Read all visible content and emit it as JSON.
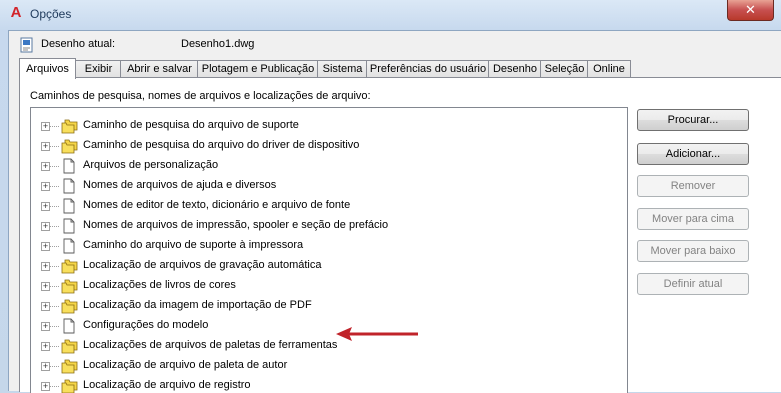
{
  "window": {
    "title": "Opções"
  },
  "current_drawing": {
    "label": "Desenho atual:",
    "value": "Desenho1.dwg"
  },
  "tabs": [
    {
      "label": "Arquivos",
      "active": true
    },
    {
      "label": "Exibir"
    },
    {
      "label": "Abrir e salvar"
    },
    {
      "label": "Plotagem e Publicação"
    },
    {
      "label": "Sistema"
    },
    {
      "label": "Preferências do usuário"
    },
    {
      "label": "Desenho"
    },
    {
      "label": "Seleção"
    },
    {
      "label": "Online"
    }
  ],
  "files": {
    "section_label": "Caminhos de pesquisa, nomes de arquivos e localizações de arquivo:",
    "items": [
      {
        "label": "Caminho de pesquisa do arquivo de suporte",
        "icon": "folders-icon"
      },
      {
        "label": "Caminho de pesquisa do arquivo do driver de dispositivo",
        "icon": "folders-icon"
      },
      {
        "label": "Arquivos de personalização",
        "icon": "document-icon"
      },
      {
        "label": "Nomes de arquivos de ajuda e diversos",
        "icon": "document-icon"
      },
      {
        "label": "Nomes de editor de texto, dicionário e arquivo de fonte",
        "icon": "document-icon"
      },
      {
        "label": "Nomes de arquivos de impressão, spooler e seção de prefácio",
        "icon": "document-icon"
      },
      {
        "label": "Caminho do arquivo de suporte à impressora",
        "icon": "document-icon"
      },
      {
        "label": "Localização de arquivos de gravação automática",
        "icon": "folders-icon"
      },
      {
        "label": "Localizações de livros de cores",
        "icon": "folders-icon"
      },
      {
        "label": "Localização da imagem de importação de PDF",
        "icon": "folders-icon"
      },
      {
        "label": "Configurações do modelo",
        "icon": "document-icon"
      },
      {
        "label": "Localizações de arquivos de paletas de ferramentas",
        "icon": "folders-icon"
      },
      {
        "label": "Localização de arquivo de paleta de autor",
        "icon": "folders-icon"
      },
      {
        "label": "Localização de arquivo de registro",
        "icon": "folders-icon"
      }
    ]
  },
  "buttons": {
    "browse": "Procurar...",
    "add": "Adicionar...",
    "remove": "Remover",
    "move_up": "Mover para cima",
    "move_down": "Mover para baixo",
    "set_current": "Definir atual"
  },
  "colors": {
    "annotation_arrow": "#c0232a",
    "folder": "#f5d547"
  }
}
